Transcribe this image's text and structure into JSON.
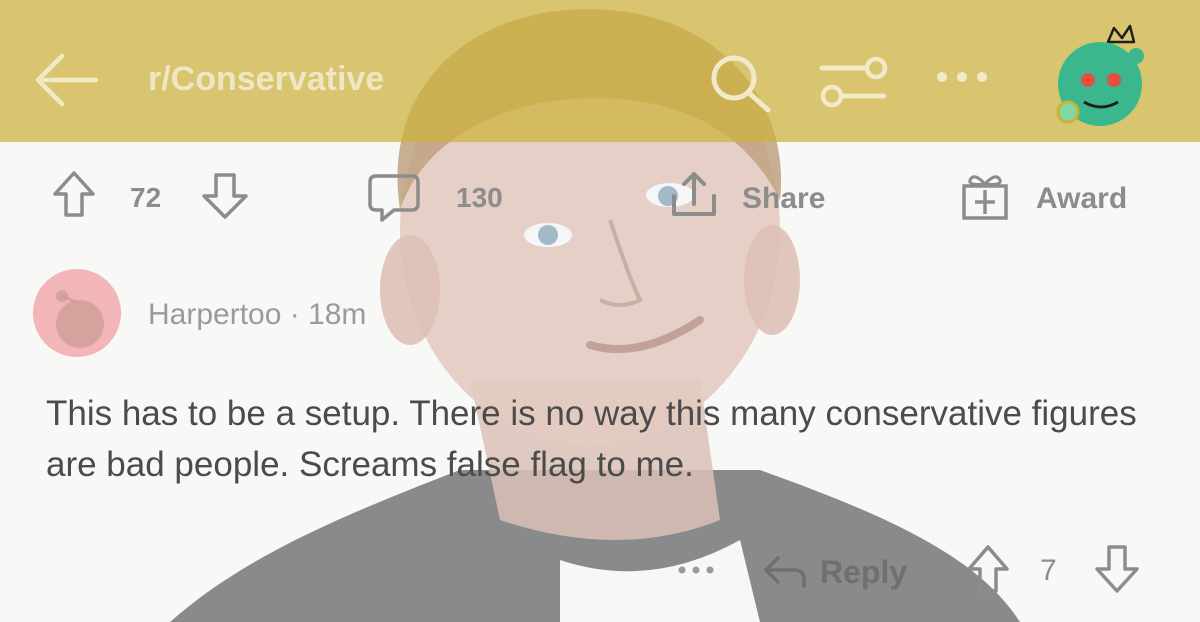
{
  "header": {
    "subreddit": "r/Conservative",
    "back_icon": "back-arrow-icon",
    "search_icon": "search-icon",
    "filter_icon": "sort-filter-icon",
    "more_icon": "more-dots-icon",
    "avatar_icon": "user-avatar-icon",
    "bar_color": "#cdb23a"
  },
  "post_actions": {
    "vote_count": "72",
    "comment_count": "130",
    "share_label": "Share",
    "award_label": "Award"
  },
  "comment": {
    "author": "Harpertoo",
    "separator": "·",
    "age": "18m",
    "author_line": "Harpertoo · 18m",
    "body": "This has to be a setup. There is no way this many conservative figures are bad people. Screams false flag to me.",
    "reply_label": "Reply",
    "vote_count": "7",
    "avatar_color": "#f2b5b8"
  },
  "colors": {
    "avatar_green": "#3bb78f",
    "text_gray": "#8c8c8c"
  }
}
